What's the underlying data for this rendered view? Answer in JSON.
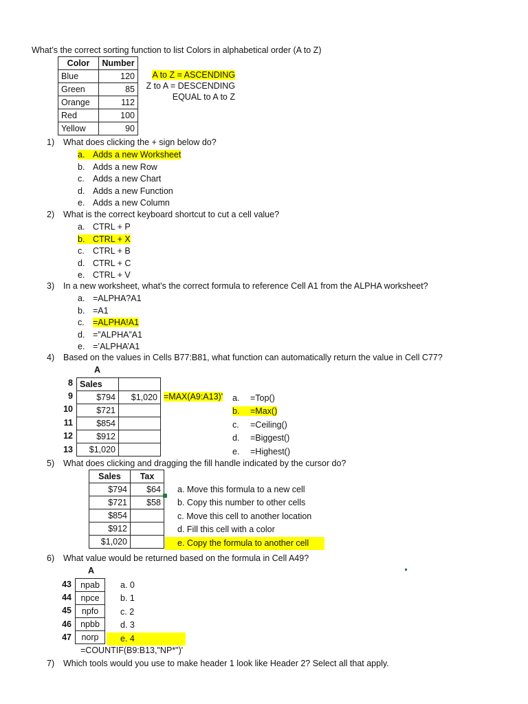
{
  "intro": {
    "question": "What’s the correct sorting function to list Colors in alphabetical order (A to Z)",
    "table": {
      "headers": [
        "Color",
        "Number"
      ],
      "rows": [
        [
          "Blue",
          "120"
        ],
        [
          "Green",
          "85"
        ],
        [
          "Orange",
          "112"
        ],
        [
          "Red",
          "100"
        ],
        [
          "Yellow",
          "90"
        ]
      ]
    },
    "notes": [
      "A to Z = ASCENDING",
      "Z to A = DESCENDING",
      "EQUAL to A to Z"
    ]
  },
  "q1": {
    "number": "1)",
    "text": "What does clicking the + sign below do?",
    "options": [
      {
        "letter": "a.",
        "text": "Adds a new Worksheet"
      },
      {
        "letter": "b.",
        "text": "Adds a new Row"
      },
      {
        "letter": "c.",
        "text": "Adds a new Chart"
      },
      {
        "letter": "d.",
        "text": "Adds a new Function"
      },
      {
        "letter": "e.",
        "text": "Adds a new Column"
      }
    ]
  },
  "q2": {
    "number": "2)",
    "text": "What is the correct keyboard shortcut to cut a cell value?",
    "options": [
      {
        "letter": "a.",
        "text": "CTRL + P"
      },
      {
        "letter": "b.",
        "text": "CTRL + X"
      },
      {
        "letter": "c.",
        "text": "CTRL + B"
      },
      {
        "letter": "d.",
        "text": "CTRL + C"
      },
      {
        "letter": "e.",
        "text": "CTRL + V"
      }
    ]
  },
  "q3": {
    "number": "3)",
    "text": "In a new worksheet, what’s the correct formula to reference Cell A1 from the ALPHA worksheet?",
    "options": [
      {
        "letter": "a.",
        "text": "=ALPHA?A1"
      },
      {
        "letter": "b.",
        "text": "=A1"
      },
      {
        "letter": "c.",
        "text": "=ALPHA!A1"
      },
      {
        "letter": "d.",
        "text": "=”ALPHA”A1"
      },
      {
        "letter": "e.",
        "text": "=’ALPHA’A1"
      }
    ]
  },
  "q4": {
    "number": "4)",
    "text": "Based on the values in Cells B77:B81, what function can automatically return the value in Cell C77?",
    "column_header": "A",
    "row_labels": [
      "8",
      "9",
      "10",
      "11",
      "12",
      "13"
    ],
    "cells": [
      [
        "Sales",
        ""
      ],
      [
        "$794",
        "$1,020"
      ],
      [
        "$721",
        ""
      ],
      [
        "$854",
        ""
      ],
      [
        "$912",
        ""
      ],
      [
        "$1,020",
        ""
      ]
    ],
    "formula": "=MAX(A9:A13)'",
    "options": [
      {
        "letter": "a.",
        "text": "=Top()"
      },
      {
        "letter": "b.",
        "text": "=Max()"
      },
      {
        "letter": "c.",
        "text": "=Ceiling()"
      },
      {
        "letter": "d.",
        "text": "=Biggest()"
      },
      {
        "letter": "e.",
        "text": "=Highest()"
      }
    ]
  },
  "q5": {
    "number": "5)",
    "text": "What does clicking and dragging the fill handle indicated by the cursor do?",
    "table": {
      "headers": [
        "Sales",
        "Tax"
      ],
      "rows": [
        [
          "$794",
          "$64"
        ],
        [
          "$721",
          "$58"
        ],
        [
          "$854",
          ""
        ],
        [
          "$912",
          ""
        ],
        [
          "$1,020",
          ""
        ]
      ]
    },
    "options": [
      {
        "letter": "a.",
        "text": "Move this formula to a new cell"
      },
      {
        "letter": "b.",
        "text": "Copy this number to other cells"
      },
      {
        "letter": "c.",
        "text": "Move this cell to another location"
      },
      {
        "letter": "d.",
        "text": "Fill this cell with a color"
      },
      {
        "letter": "e.",
        "text": "Copy the formula to another cell"
      }
    ]
  },
  "q6": {
    "number": "6)",
    "text": "What value would be returned based on the formula in Cell A49?",
    "column_header": "A",
    "row_labels": [
      "43",
      "44",
      "45",
      "46",
      "47"
    ],
    "cells": [
      "npab",
      "npce",
      "npfo",
      "npbb",
      "norp"
    ],
    "options": [
      {
        "letter": "a.",
        "text": "0"
      },
      {
        "letter": "b.",
        "text": "1"
      },
      {
        "letter": "c.",
        "text": "2"
      },
      {
        "letter": "d.",
        "text": "3"
      },
      {
        "letter": "e.",
        "text": "4"
      }
    ],
    "formula": "=COUNTIF(B9:B13,\"NP*\")'"
  },
  "q7": {
    "number": "7)",
    "text": "Which tools would you use to make header 1 look like Header 2? Select all that apply."
  },
  "colors": {
    "highlight": "#ffff00",
    "fill_handle": "#1e7b3c"
  }
}
